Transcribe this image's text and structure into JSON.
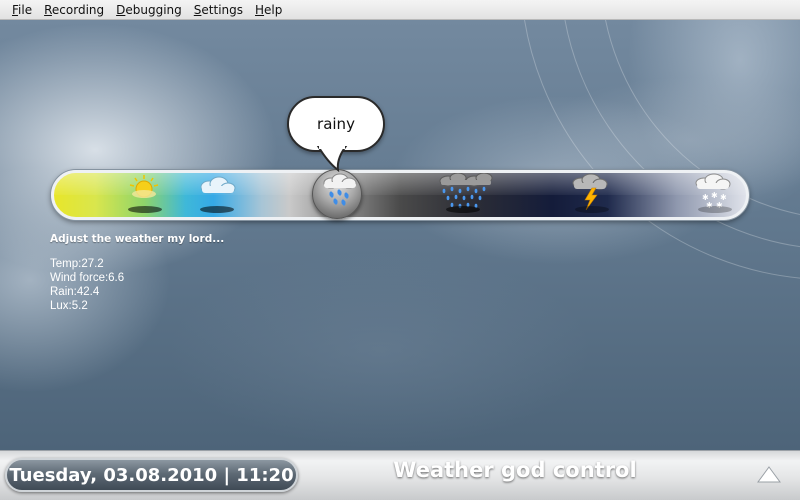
{
  "menu": {
    "items": [
      {
        "mnemonic": "F",
        "rest": "ile"
      },
      {
        "mnemonic": "R",
        "rest": "ecording"
      },
      {
        "mnemonic": "D",
        "rest": "ebugging"
      },
      {
        "mnemonic": "S",
        "rest": "ettings"
      },
      {
        "mnemonic": "H",
        "rest": "elp"
      }
    ]
  },
  "slider": {
    "states": [
      "sunny-icon",
      "cloudy-icon",
      "rainy-icon",
      "heavy-rain-icon",
      "thunderstorm-icon",
      "snow-icon"
    ],
    "selected": "rainy-icon",
    "bubble_label": "rainy"
  },
  "prompt": "Adjust the weather my lord...",
  "readouts": {
    "temp": "Temp:27.2",
    "wind": "Wind force:6.6",
    "rain": "Rain:42.4",
    "lux": "Lux:5.2"
  },
  "bottom": {
    "datetime": "Tuesday, 03.08.2010 | 11:20",
    "title": "Weather god control"
  },
  "colors": {
    "sun": "#f4d400",
    "rain": "#3f8de6",
    "bolt": "#ffb400",
    "menu_bg": "#e9e9e9"
  }
}
